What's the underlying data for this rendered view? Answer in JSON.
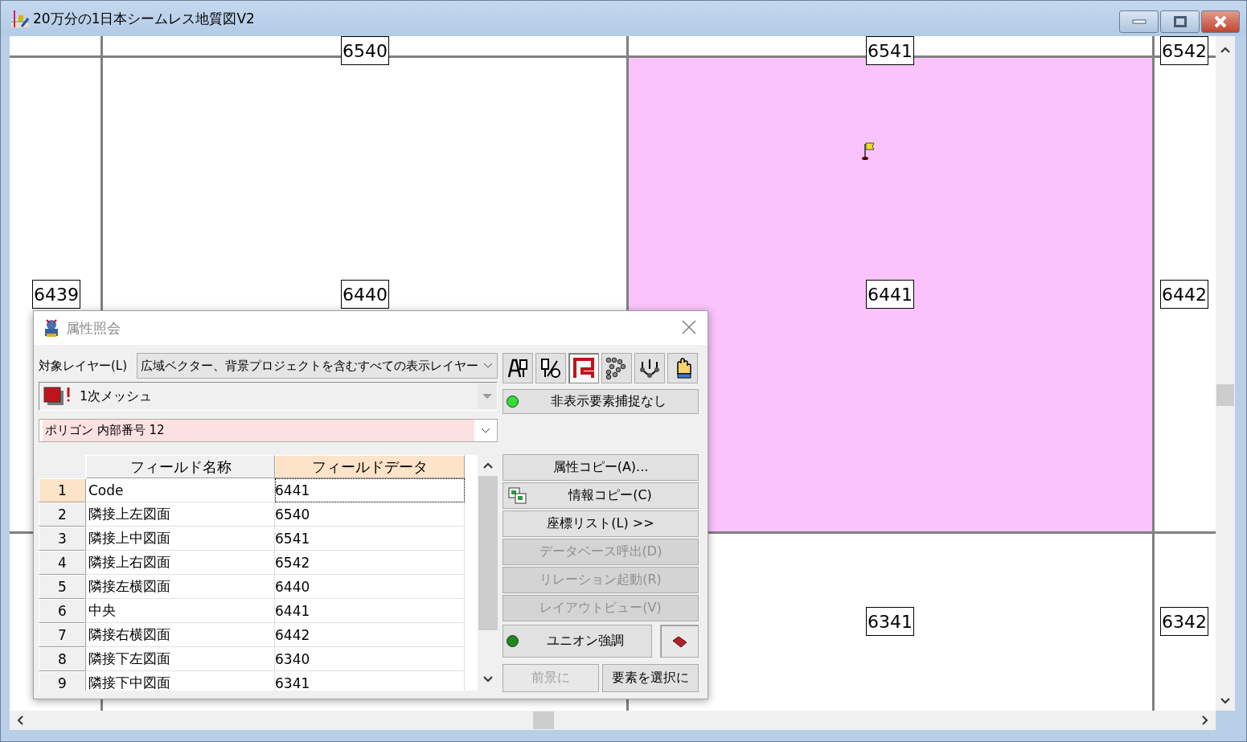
{
  "window": {
    "title": "20万分の1日本シームレス地質図V2"
  },
  "map": {
    "labels": [
      {
        "text": "6540",
        "selected": false
      },
      {
        "text": "6541",
        "selected": false
      },
      {
        "text": "6542",
        "selected": false
      },
      {
        "text": "6439",
        "selected": false
      },
      {
        "text": "6440",
        "selected": false
      },
      {
        "text": "6441",
        "selected": true
      },
      {
        "text": "6442",
        "selected": false
      },
      {
        "text": "6341",
        "selected": false
      },
      {
        "text": "6342",
        "selected": false
      }
    ]
  },
  "dialog": {
    "title": "属性照会",
    "layer_label": "対象レイヤー(L)",
    "layer_select": "広域ベクター、背景プロジェクトを含むすべての表示レイヤー",
    "layer_name": "1次メッシュ",
    "element_select": "ポリゴン 内部番号 12",
    "tools": [
      {
        "kind": "text",
        "selected": false
      },
      {
        "kind": "split",
        "selected": false
      },
      {
        "kind": "polygon",
        "selected": true
      },
      {
        "kind": "points",
        "selected": false
      },
      {
        "kind": "nodes",
        "selected": false
      },
      {
        "kind": "hand",
        "selected": false
      }
    ],
    "hidden_toggle": {
      "label": "非表示要素捕捉なし",
      "on": true
    },
    "table": {
      "columns": [
        {
          "label": "フィールド名称",
          "selected": false
        },
        {
          "label": "フィールドデータ",
          "selected": true
        }
      ],
      "rows": [
        {
          "number": "1",
          "name": "Code",
          "value": "6441",
          "selected": true
        },
        {
          "number": "2",
          "name": "隣接上左図面",
          "value": "6540",
          "selected": false
        },
        {
          "number": "3",
          "name": "隣接上中図面",
          "value": "6541",
          "selected": false
        },
        {
          "number": "4",
          "name": "隣接上右図面",
          "value": "6542",
          "selected": false
        },
        {
          "number": "5",
          "name": "隣接左横図面",
          "value": "6440",
          "selected": false
        },
        {
          "number": "6",
          "name": "中央",
          "value": "6441",
          "selected": false
        },
        {
          "number": "7",
          "name": "隣接右横図面",
          "value": "6442",
          "selected": false
        },
        {
          "number": "8",
          "name": "隣接下左図面",
          "value": "6340",
          "selected": false
        },
        {
          "number": "9",
          "name": "隣接下中図面",
          "value": "6341",
          "selected": false
        }
      ]
    },
    "actions": [
      {
        "kind": "plain",
        "label": "属性コピー(A)...",
        "disabled": false
      },
      {
        "kind": "icon",
        "label": "情報コピー(C)",
        "disabled": false
      },
      {
        "kind": "plain",
        "label": "座標リスト(L) >>",
        "disabled": false
      },
      {
        "kind": "plain",
        "label": "データベース呼出(D)",
        "disabled": true
      },
      {
        "kind": "plain",
        "label": "リレーション起動(R)",
        "disabled": true
      },
      {
        "kind": "plain",
        "label": "レイアウトビュー(V)",
        "disabled": true
      }
    ],
    "union_toggle": {
      "label": "ユニオン強調",
      "on": true
    },
    "bottom_buttons": [
      {
        "label": "前景に",
        "disabled": true
      },
      {
        "label": "要素を選択に",
        "disabled": false
      }
    ]
  }
}
